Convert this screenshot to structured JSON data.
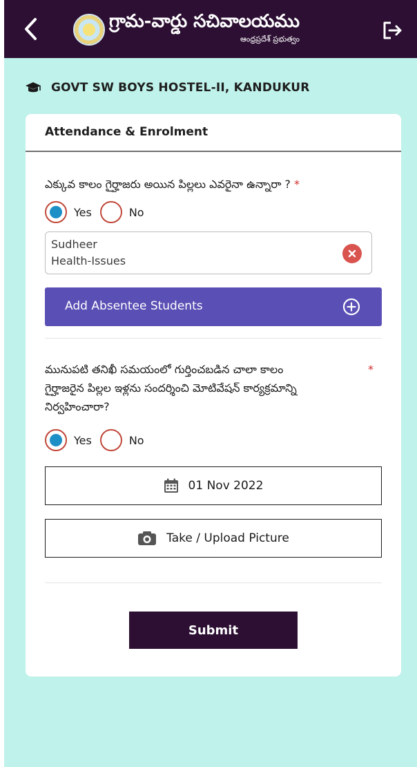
{
  "header": {
    "title": "గ్రామ-వార్డు సచివాలయము",
    "subtitle": "ఆంధ్రప్రదేశ్ ప్రభుత్వం",
    "back_icon": "chevron-left-icon",
    "logout_icon": "logout-icon",
    "logo": "ap-government-emblem"
  },
  "hostel": {
    "icon": "graduation-cap-icon",
    "name": "GOVT SW BOYS HOSTEL-II, KANDUKUR"
  },
  "card": {
    "title": "Attendance & Enrolment",
    "question1": {
      "text": "ఎక్కువ కాలం గైర్హాజరు అయిన పిల్లలు ఎవరైనా ఉన్నారా ?",
      "required_mark": "*",
      "options": [
        {
          "label": "Yes",
          "selected": true
        },
        {
          "label": "No",
          "selected": false
        }
      ]
    },
    "absentee": {
      "name": "Sudheer",
      "reason": "Health-Issues",
      "remove_icon": "close-circle-icon"
    },
    "add_absentee": {
      "label": "Add Absentee Students",
      "icon": "plus-circle-icon"
    },
    "question2": {
      "line1": "మునుపటి తనిఖీ సమయంలో గుర్తించబడిన చాలా కాలం",
      "line2": "గైర్హాజరైన పిల్లల ఇళ్లను సందర్శించి మోటివేషన్ కార్యక్రమాన్ని",
      "line3": "నిర్వహించారా?",
      "required_mark": "*",
      "options": [
        {
          "label": "Yes",
          "selected": true
        },
        {
          "label": "No",
          "selected": false
        }
      ]
    },
    "date": {
      "value": "01 Nov 2022",
      "icon": "calendar-icon"
    },
    "upload": {
      "label": "Take / Upload Picture",
      "icon": "camera-icon"
    },
    "submit_label": "Submit"
  },
  "colors": {
    "header_bg": "#2c0f33",
    "page_bg": "#bff2ea",
    "accent": "#5a4fb5",
    "radio_selected": "#1d8fc7",
    "radio_ring": "#c0473a",
    "remove": "#d9534f",
    "required": "#d22a2a"
  }
}
